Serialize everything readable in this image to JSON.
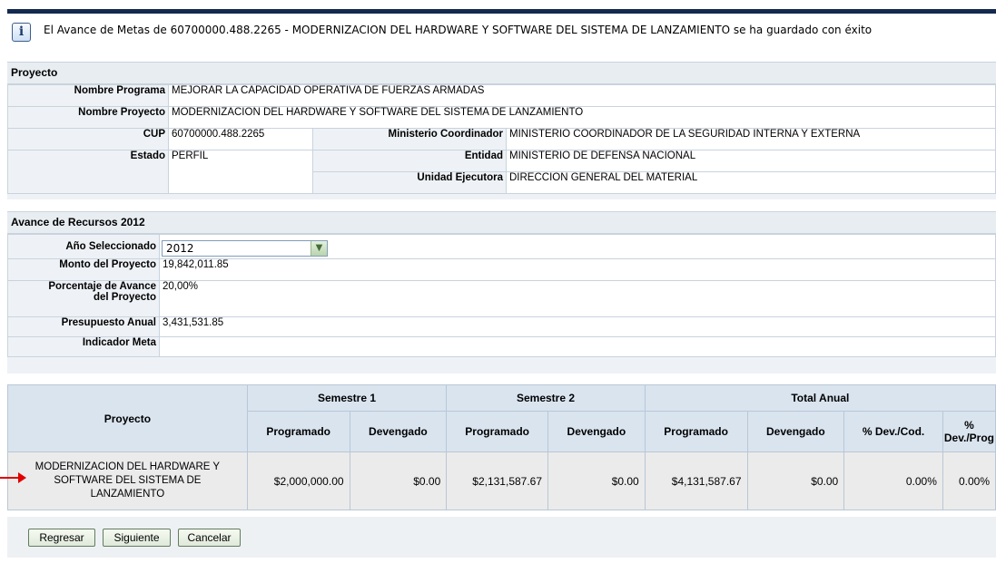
{
  "message": "El Avance de Metas de 60700000.488.2265 - MODERNIZACION DEL HARDWARE Y SOFTWARE DEL SISTEMA DE LANZAMIENTO se ha guardado con éxito",
  "project_section": {
    "title": "Proyecto",
    "nombre_programa_label": "Nombre Programa",
    "nombre_programa": "MEJORAR LA CAPACIDAD OPERATIVA DE FUERZAS ARMADAS",
    "nombre_proyecto_label": "Nombre Proyecto",
    "nombre_proyecto": "MODERNIZACION DEL HARDWARE Y SOFTWARE DEL SISTEMA DE LANZAMIENTO",
    "cup_label": "CUP",
    "cup": "60700000.488.2265",
    "estado_label": "Estado",
    "estado": "PERFIL",
    "ministerio_label": "Ministerio Coordinador",
    "ministerio": "MINISTERIO COORDINADOR DE LA SEGURIDAD INTERNA Y EXTERNA",
    "entidad_label": "Entidad",
    "entidad": "MINISTERIO DE DEFENSA NACIONAL",
    "unidad_label": "Unidad Ejecutora",
    "unidad": "DIRECCION GENERAL DEL MATERIAL"
  },
  "resources_section": {
    "title": "Avance de Recursos 2012",
    "anio_label": "Año Seleccionado",
    "anio": "2012",
    "monto_label": "Monto del Proyecto",
    "monto": "19,842,011.85",
    "porcentaje_label_1": "Porcentaje de Avance",
    "porcentaje_label_2": "del Proyecto",
    "porcentaje": "20,00%",
    "presupuesto_label": "Presupuesto Anual",
    "presupuesto": "3,431,531.85",
    "indicador_label": "Indicador Meta",
    "indicador": ""
  },
  "results_table": {
    "proyecto_header": "Proyecto",
    "semestre1": "Semestre 1",
    "semestre2": "Semestre 2",
    "total_anual": "Total Anual",
    "programado": "Programado",
    "devengado": "Devengado",
    "dev_cod": "% Dev./Cod.",
    "dev_prog_1": "%",
    "dev_prog_2": "Dev./Prog",
    "row": {
      "proyecto_1": "MODERNIZACION DEL HARDWARE Y",
      "proyecto_2": "SOFTWARE DEL SISTEMA DE",
      "proyecto_3": "LANZAMIENTO",
      "s1_programado": "$2,000,000.00",
      "s1_devengado": "$0.00",
      "s2_programado": "$2,131,587.67",
      "s2_devengado": "$0.00",
      "total_programado": "$4,131,587.67",
      "total_devengado": "$0.00",
      "dev_cod": "0.00%",
      "dev_prog": "0.00%"
    }
  },
  "buttons": {
    "regresar": "Regresar",
    "siguiente": "Siguiente",
    "cancelar": "Cancelar"
  },
  "colors": {
    "header_bar": "#13294f",
    "section_bg": "#eef2f6",
    "table_header_bg": "#d9e4ef",
    "row_bg": "#ebebeb",
    "arrow": "#e00000"
  },
  "icons": {
    "message": "info-icon",
    "select": "chevron-down-icon",
    "pointer": "arrow-right-icon"
  }
}
